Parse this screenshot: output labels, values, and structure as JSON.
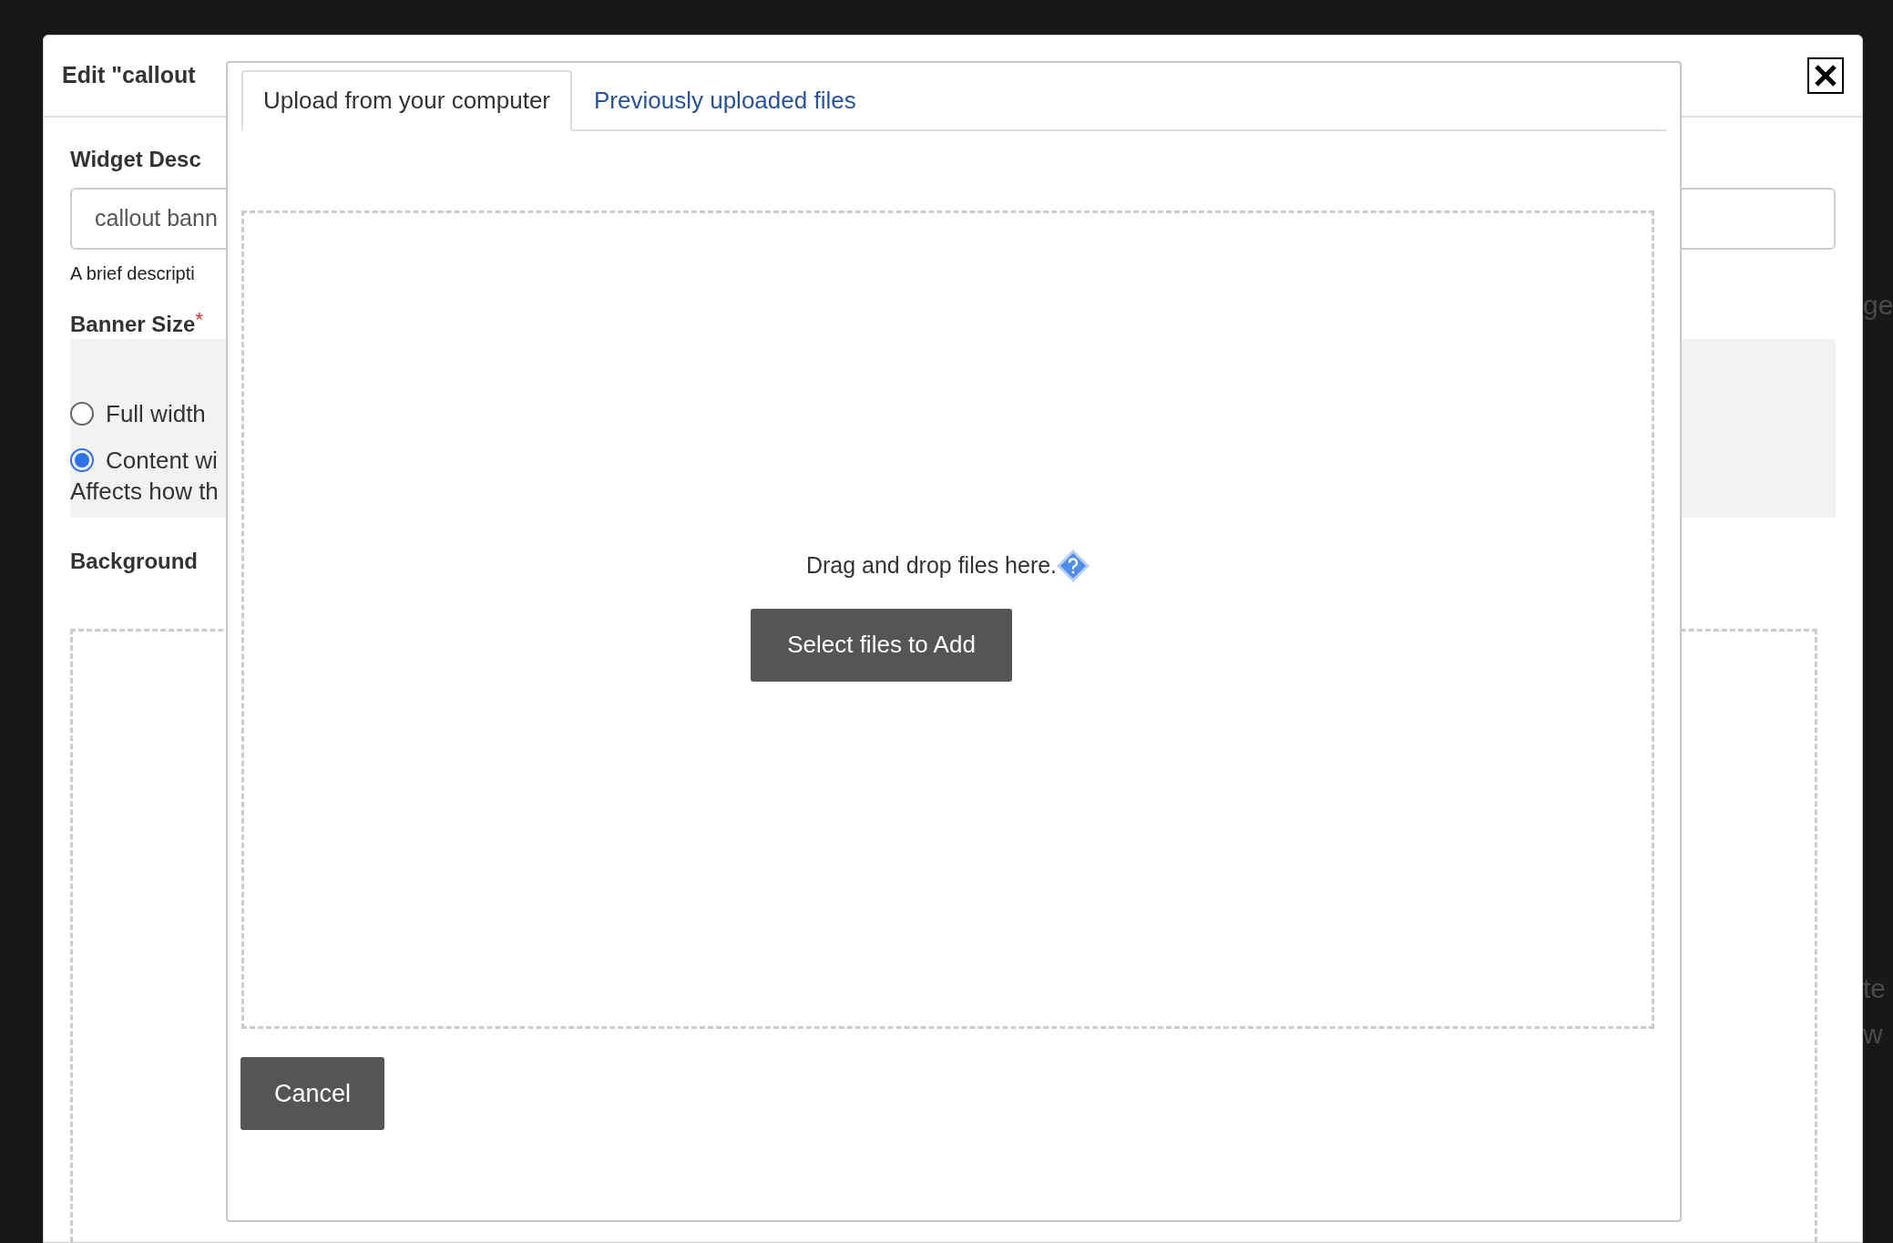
{
  "dialog": {
    "title": "Edit \"callout",
    "fields": [
      {
        "kind": "text",
        "label": "Widget Desc",
        "value": "callout bann",
        "help": "A brief descripti"
      },
      {
        "kind": "radio",
        "label": "Banner Size",
        "required_mark": "*",
        "options": [
          {
            "label": "Full width",
            "selected": false
          },
          {
            "label": "Content wi",
            "selected": true
          }
        ],
        "help": "Affects how th"
      },
      {
        "kind": "drop",
        "label": "Background"
      }
    ]
  },
  "upload_dialog": {
    "tabs": [
      {
        "label": "Upload from your computer",
        "selected": true
      },
      {
        "label": "Previously uploaded files",
        "selected": false
      }
    ],
    "drop_text": "Drag and drop files here.",
    "select_button": "Select files to Add",
    "cancel_button": "Cancel"
  },
  "background_fragments": [
    "ge",
    "te",
    "w"
  ]
}
